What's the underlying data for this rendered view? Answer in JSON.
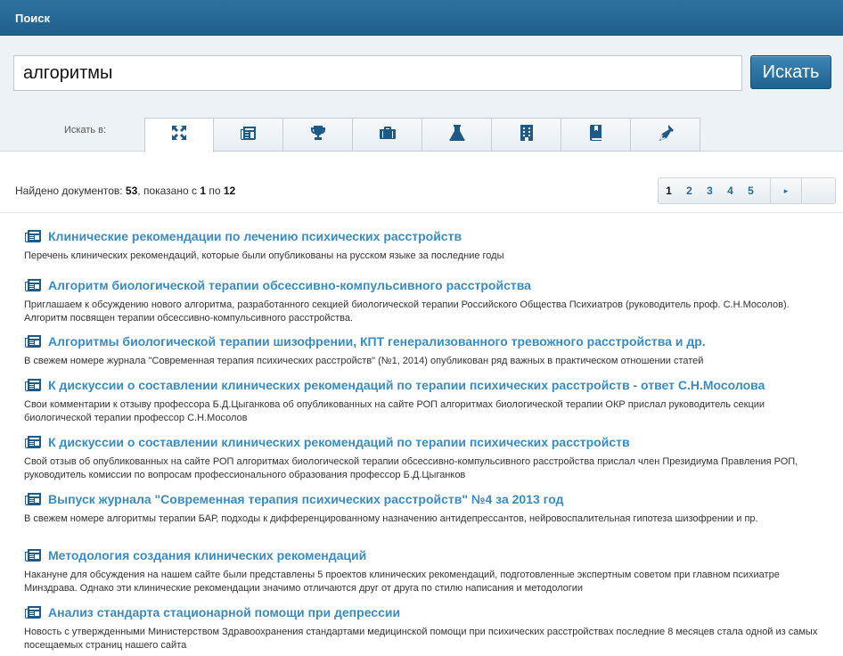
{
  "header": {
    "title": "Поиск"
  },
  "search": {
    "value": "алгоритмы",
    "button_label": "Искать",
    "search_in_label": "Искать в:"
  },
  "tabs": [
    {
      "icon": "expand-arrows-icon",
      "active": true
    },
    {
      "icon": "newspaper-icon",
      "active": false
    },
    {
      "icon": "trophy-icon",
      "active": false
    },
    {
      "icon": "briefcase-icon",
      "active": false
    },
    {
      "icon": "flask-icon",
      "active": false
    },
    {
      "icon": "building-icon",
      "active": false
    },
    {
      "icon": "book-icon",
      "active": false
    },
    {
      "icon": "pen-nib-icon",
      "active": false
    }
  ],
  "results_info": {
    "prefix": "Найдено документов:",
    "total": "53",
    "shown_prefix": ", показано с",
    "from": "1",
    "to_word": "по",
    "to": "12"
  },
  "pagination": {
    "pages": [
      "1",
      "2",
      "3",
      "4",
      "5"
    ],
    "current": "1",
    "next": "▸"
  },
  "results": [
    {
      "title": "Клинические рекомендации по лечению психических расстройств",
      "snippet": "Перечень клинических рекомендаций, которые были опубликованы на русском языке за последние годы"
    },
    {
      "title": "Алгоритм биологической терапии обсессивно-компульсивного расстройства",
      "snippet": "Приглашаем к обсуждению нового алгоритма, разработанного секцией биологической терапии Российского Общества Психиатров (руководитель проф. С.Н.Мосолов). Алгоритм посвящен терапии обсессивно-компульсивного расстройства."
    },
    {
      "title": "Алгоритмы биологической терапии шизофрении, КПТ генерализованного тревожного расстройства и др.",
      "snippet": "В свежем номере журнала \"Современная терапия психических расстройств\" (№1, 2014) опубликован ряд важных в практическом отношении статей"
    },
    {
      "title": "К дискуссии о составлении клинических рекомендаций по терапии психических расстройств - ответ С.Н.Мосолова",
      "snippet": "Свои комментарии к отзыву профессора Б.Д.Цыганкова об опубликованных на сайте РОП алгоритмах биологической терапии ОКР прислал руководитель секции биологической терапии профессор С.Н.Мосолов"
    },
    {
      "title": "К дискуссии о составлении клинических рекомендаций по терапии психических расстройств",
      "snippet": "Свой отзыв об опубликованных на сайте РОП алгоритмах биологической терапии обсессивно-компульсивного расстройства прислал член Президиума Правления РОП, руководитель комиссии по вопросам профессионального образования профессор Б.Д.Цыганков"
    },
    {
      "title": "Выпуск журнала \"Современная терапия психических расстройств\" №4 за 2013 год",
      "snippet": "В свежем номере алгоритмы терапии БАР, подходы к дифференцированному назначению антидепрессантов, нейровоспалительная гипотеза шизофрении и пр."
    },
    {
      "title": "Методология создания клинических рекомендаций",
      "snippet": "Накануне для обсуждения на нашем сайте были представлены 5 проектов клинических рекомендаций, подготовленные экспертным советом при главном психиатре Минздрава. Однако эти клинические рекомендации значимо отличаются друг от друга по стилю написания и методологии"
    },
    {
      "title": "Анализ стандарта стационарной помощи при депрессии",
      "snippet": "Новость с утвержденными Министерством Здравоохранения стандартами медицинской помощи при психических расстройствах последние 8 месяцев стала одной из самых посещаемых страниц нашего сайта"
    }
  ]
}
